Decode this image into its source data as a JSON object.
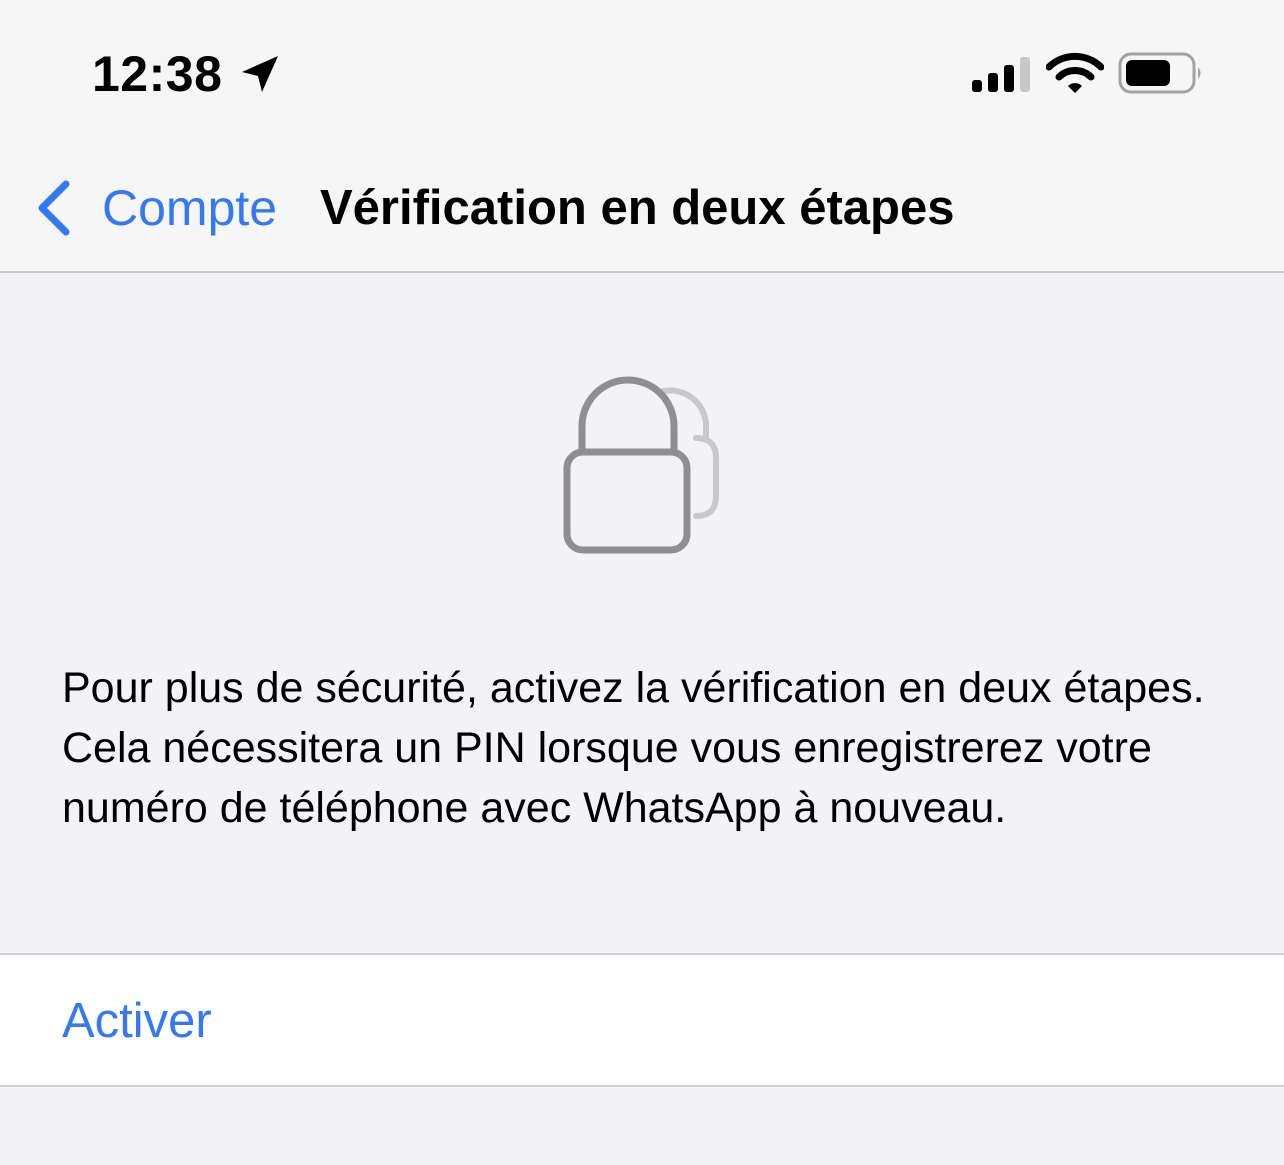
{
  "status_bar": {
    "time": "12:38",
    "icons": [
      "location-arrow-icon",
      "cellular-signal-icon",
      "wifi-icon",
      "battery-icon"
    ]
  },
  "nav": {
    "back_label": "Compte",
    "title": "Vérification en deux étapes"
  },
  "content": {
    "hero_icon": "lock-icon",
    "description": "Pour plus de sécurité, activez la vérification en deux étapes. Cela nécessitera un PIN lorsque vous enregistrerez votre numéro de téléphone avec WhatsApp à nouveau.",
    "action_label": "Activer"
  },
  "colors": {
    "accent": "#3478f6",
    "background": "#f2f2f7",
    "header_background": "#f6f6f6",
    "icon_gray": "#8e8e93"
  }
}
